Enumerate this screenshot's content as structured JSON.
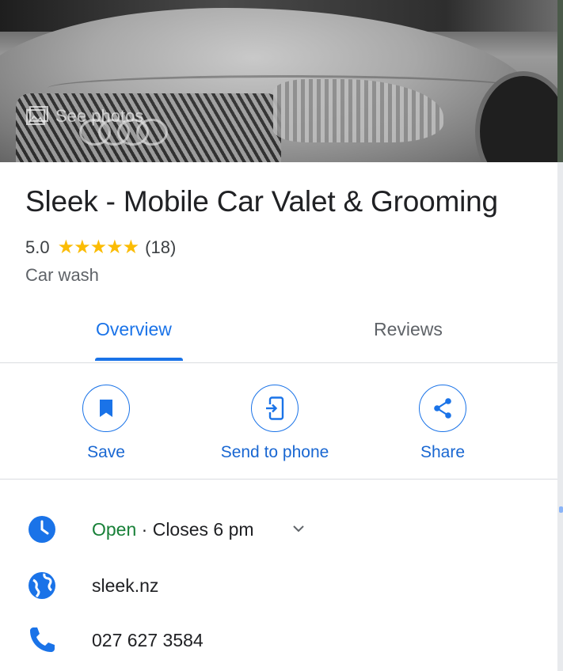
{
  "hero": {
    "see_photos_label": "See photos"
  },
  "place": {
    "name": "Sleek - Mobile Car Valet & Grooming",
    "rating": "5.0",
    "stars": "★★★★★",
    "review_count": "(18)",
    "category": "Car wash"
  },
  "tabs": [
    {
      "label": "Overview",
      "active": true
    },
    {
      "label": "Reviews",
      "active": false
    }
  ],
  "actions": {
    "save": "Save",
    "send_to_phone": "Send to phone",
    "share": "Share"
  },
  "info": {
    "hours_status": "Open",
    "hours_detail": " · Closes 6 pm",
    "website": "sleek.nz",
    "phone": "027 627 3584"
  },
  "colors": {
    "accent": "#1a73e8",
    "open_green": "#188038",
    "star": "#fbbc04"
  }
}
